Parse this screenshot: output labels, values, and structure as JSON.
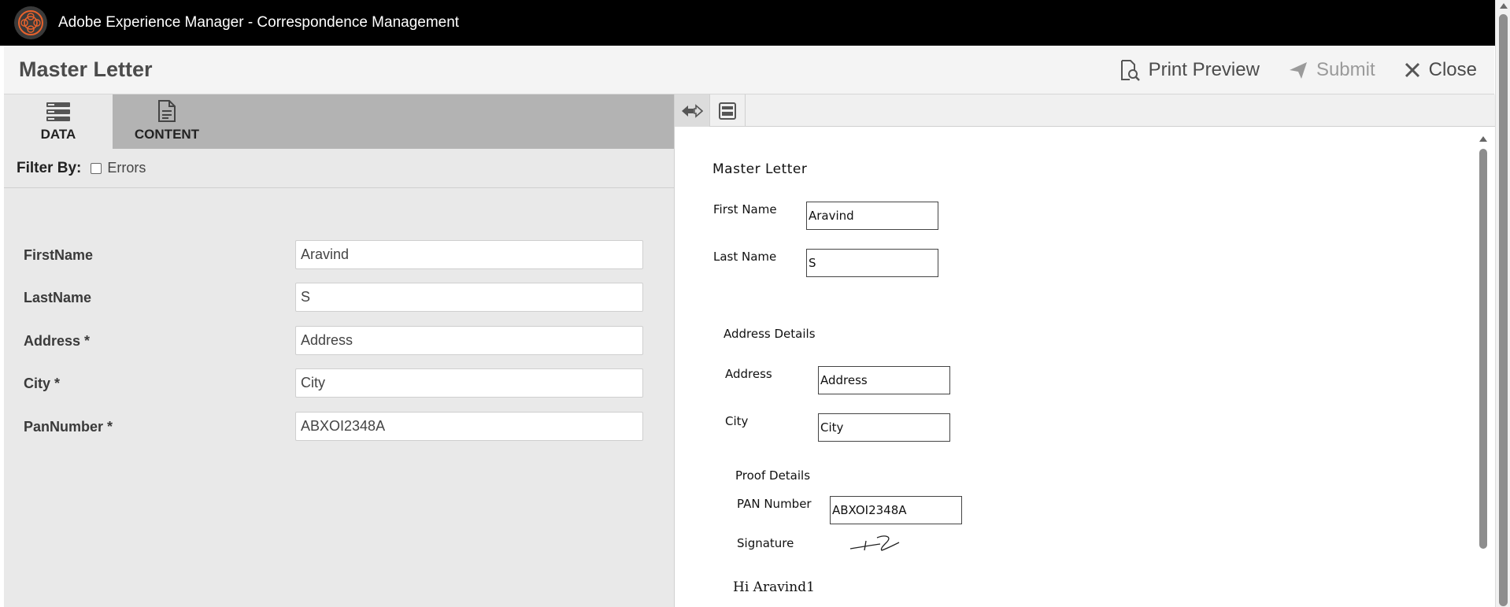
{
  "app": {
    "title": "Adobe Experience Manager - Correspondence Management"
  },
  "header": {
    "title": "Master Letter",
    "print_preview_label": "Print Preview",
    "submit_label": "Submit",
    "close_label": "Close"
  },
  "tabs": [
    {
      "label": "DATA",
      "active": true
    },
    {
      "label": "CONTENT",
      "active": false
    }
  ],
  "filter": {
    "label": "Filter By:",
    "option": "Errors",
    "checked": false
  },
  "form": {
    "fields": [
      {
        "label": "FirstName",
        "value": "Aravind"
      },
      {
        "label": "LastName",
        "value": "S"
      },
      {
        "label": "Address *",
        "value": "Address"
      },
      {
        "label": "City *",
        "value": "City"
      },
      {
        "label": "PanNumber *",
        "value": "ABXOI2348A"
      }
    ]
  },
  "preview": {
    "title": "Master Letter",
    "first_name_label": "First Name",
    "first_name_value": "Aravind",
    "last_name_label": "Last Name",
    "last_name_value": "S",
    "address_section": "Address Details",
    "address_label": "Address",
    "address_value": "Address",
    "city_label": "City",
    "city_value": "City",
    "proof_section": "Proof Details",
    "pan_label": "PAN Number",
    "pan_value": "ABXOI2348A",
    "signature_label": "Signature",
    "greeting": "Hi Aravind1"
  },
  "colors": {
    "appbar": "#000000",
    "logo_accent": "#e8622c",
    "tabstrip": "#b3b3b3",
    "panel": "#e9e9e9"
  }
}
